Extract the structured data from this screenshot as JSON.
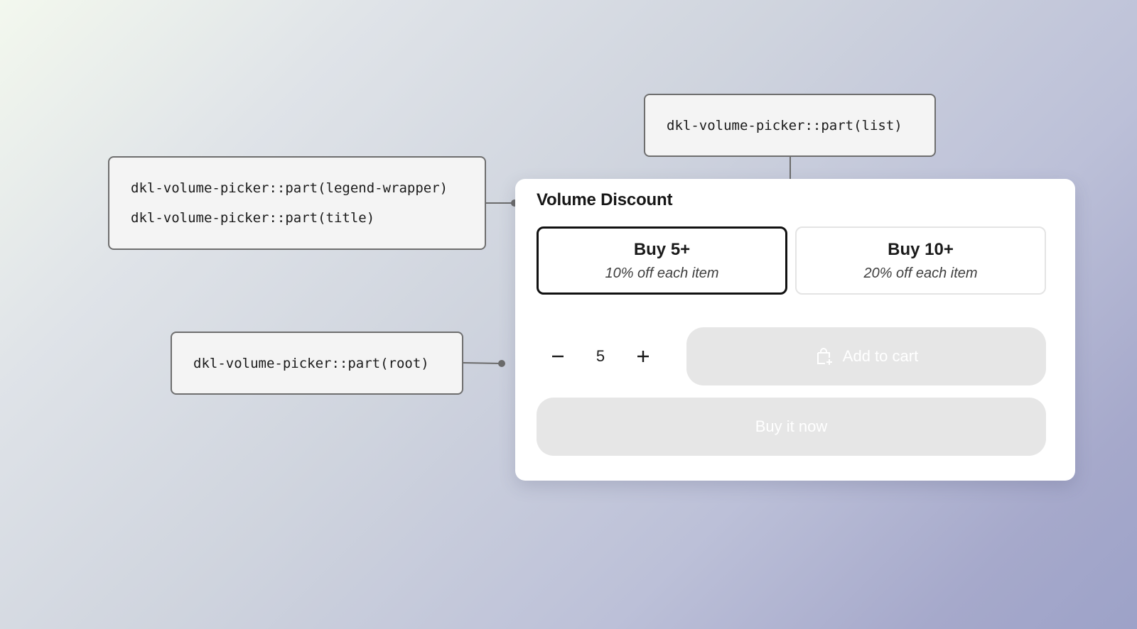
{
  "annotations": {
    "legend_wrapper": "dkl-volume-picker::part(legend-wrapper)",
    "title": "dkl-volume-picker::part(title)",
    "root": "dkl-volume-picker::part(root)",
    "list": "dkl-volume-picker::part(list)"
  },
  "widget": {
    "title": "Volume Discount",
    "options": [
      {
        "label": "Buy 5+",
        "description": "10% off each item",
        "selected": true
      },
      {
        "label": "Buy 10+",
        "description": "20% off each item",
        "selected": false
      }
    ],
    "quantity": "5",
    "add_to_cart_label": "Add to cart",
    "buy_now_label": "Buy it now"
  },
  "icons": {
    "decrement": "minus-icon",
    "increment": "plus-icon",
    "cart": "shopping-bag-plus-icon"
  },
  "colors": {
    "selected_border": "#111111",
    "disabled_button": "#e6e6e6",
    "annotation_border": "#6e6e6e"
  }
}
